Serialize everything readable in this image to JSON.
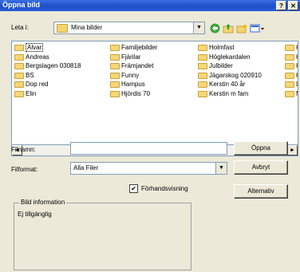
{
  "window": {
    "title": "Öppna bild",
    "help_button": "?",
    "close_button": "✕"
  },
  "lookin": {
    "label": "Leta i:",
    "value": "Mina bilder"
  },
  "toolbar": {
    "back_icon": "back-arrow-icon",
    "up_icon": "up-folder-icon",
    "new_folder_icon": "new-folder-icon",
    "views_icon": "views-menu-icon"
  },
  "file_list": {
    "columns": [
      [
        "Alvar",
        "Andreas",
        "Bergslagen 030818",
        "BS",
        "Dop red",
        "Elin"
      ],
      [
        "Familjebilder",
        "Fjärilar",
        "Främjandet",
        "Funny",
        "Hampus",
        "Hjördis 70"
      ],
      [
        "Holmfast",
        "Höglekardalen",
        "Julbilder",
        "Jägarskog 020910",
        "Kerstin 40 år",
        "Kerstin m fam"
      ],
      [
        "K",
        "K",
        "K",
        "K",
        "L",
        "M"
      ]
    ]
  },
  "scrollbar": {
    "left_arrow": "◄",
    "right_arrow": "►"
  },
  "filename": {
    "label": "Filnamn:",
    "value": ""
  },
  "filetype": {
    "label": "Filformat:",
    "value": "Alla Filer"
  },
  "buttons": {
    "open": "Öppna",
    "cancel": "Avbryt",
    "options": "Alternativ"
  },
  "preview": {
    "label": "Förhandsvisning",
    "checked": true
  },
  "info": {
    "legend": "Bild information",
    "text": "Ej tillgänglig"
  },
  "colors": {
    "titlebar": "#1d4fc8",
    "dialog": "#ece9d8",
    "folder": "#f6d776"
  }
}
